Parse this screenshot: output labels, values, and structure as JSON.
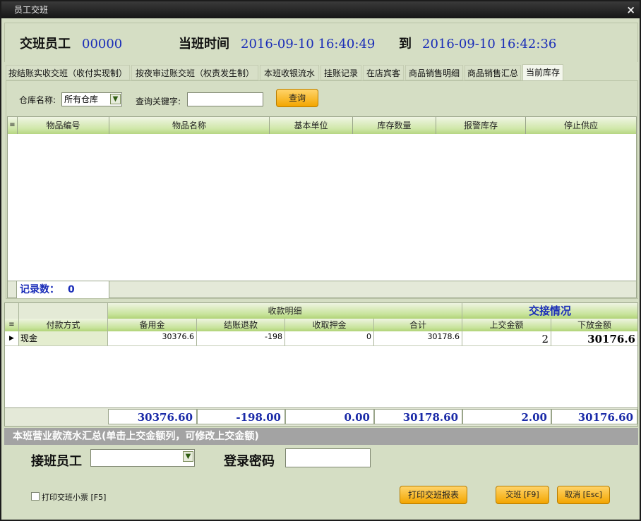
{
  "window": {
    "title": "员工交班",
    "close_glyph": "×"
  },
  "header": {
    "shift_employee_label": "交班员工",
    "shift_employee_id": "00000",
    "shift_time_label": "当班时间",
    "start_time": "2016-09-10 16:40:49",
    "to_label": "到",
    "end_time": "2016-09-10 16:42:36"
  },
  "tabs": [
    {
      "label": "按结账实收交班（收付实现制）"
    },
    {
      "label": "按夜审过账交班（权责发生制）"
    },
    {
      "label": "本班收银流水"
    },
    {
      "label": "挂账记录"
    },
    {
      "label": "在店宾客"
    },
    {
      "label": "商品销售明细"
    },
    {
      "label": "商品销售汇总"
    },
    {
      "label": "当前库存"
    }
  ],
  "inventory": {
    "warehouse_label": "仓库名称:",
    "warehouse_value": "所有仓库",
    "keyword_label": "查询关键字:",
    "keyword_value": "",
    "query_button": "查询",
    "columns": [
      "物品编号",
      "物品名称",
      "基本单位",
      "库存数量",
      "报警库存",
      "停止供应"
    ],
    "record_count_label": "记录数：",
    "record_count": "0"
  },
  "payment": {
    "group_label": "收款明细",
    "handover_label": "交接情况",
    "columns": [
      "付款方式",
      "备用金",
      "结账退款",
      "收取押金",
      "合计",
      "上交金额",
      "下放金额"
    ],
    "rows": [
      {
        "method": "现金",
        "reserve": "30376.6",
        "refund": "-198",
        "deposit": "0",
        "total": "30178.6",
        "handed_in": "2",
        "handed_down": "30176.6"
      }
    ],
    "totals": {
      "reserve": "30376.60",
      "refund": "-198.00",
      "deposit": "0.00",
      "total": "30178.60",
      "handed_in": "2.00",
      "handed_down": "30176.60"
    }
  },
  "summary_bar": "本班营业款流水汇总(单击上交金额列，可修改上交金额)",
  "handover": {
    "receiver_label": "接班员工",
    "receiver_value": "",
    "password_label": "登录密码",
    "password_value": ""
  },
  "footer": {
    "print_receipt_label": "打印交班小票 [F5]",
    "print_report_button": "打印交班报表",
    "confirm_button": "交班 [F9]",
    "cancel_button": "取消 [Esc]"
  },
  "colors": {
    "accent_blue": "#1a2db8",
    "button_orange": "#f3a500",
    "header_green": "#c9e49d",
    "window_bg": "#d5dec4"
  }
}
